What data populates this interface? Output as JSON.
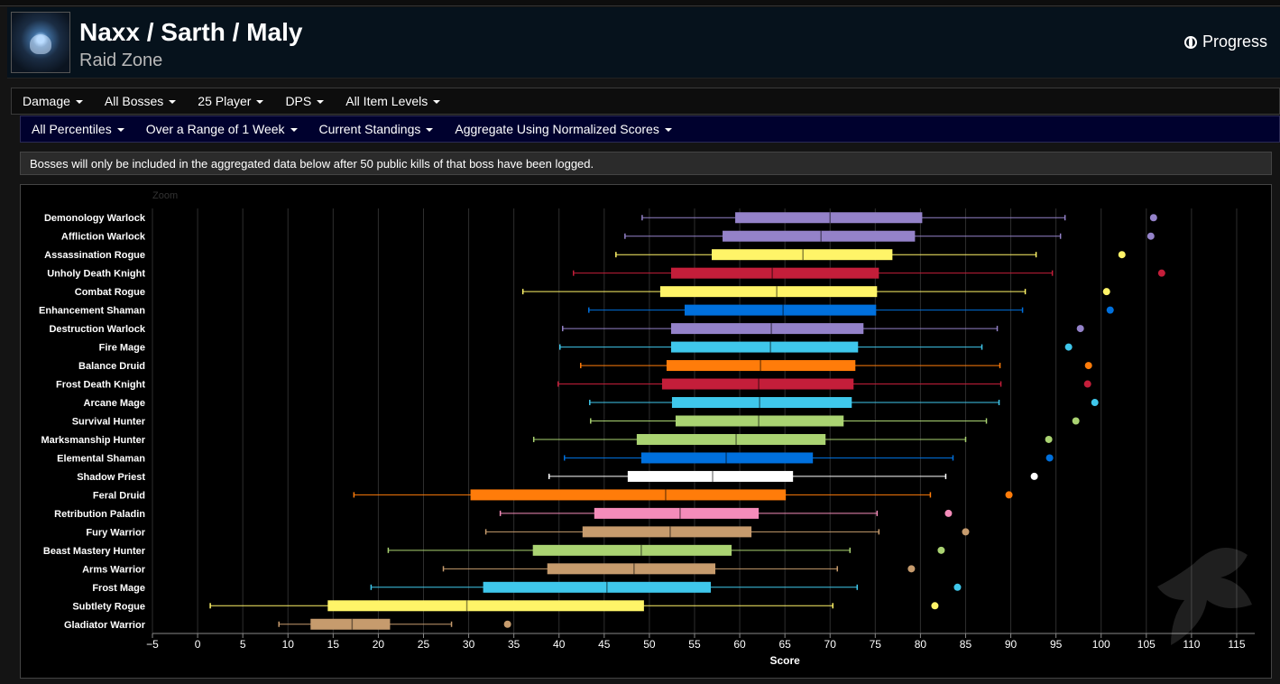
{
  "header": {
    "title": "Naxx / Sarth / Maly",
    "subtitle": "Raid Zone",
    "progress_label": "Progress",
    "icon": "raid-zone-icon"
  },
  "filters_row1": [
    "Damage",
    "All Bosses",
    "25 Player",
    "DPS",
    "All Item Levels"
  ],
  "filters_row2": [
    "All Percentiles",
    "Over a Range of 1 Week",
    "Current Standings",
    "Aggregate Using Normalized Scores"
  ],
  "notice": "Bosses will only be included in the aggregated data below after 50 public kills of that boss have been logged.",
  "chart_data": {
    "type": "boxplot",
    "orientation": "horizontal",
    "zoom_label": "Zoom",
    "xlabel": "Score",
    "xlim": [
      -5,
      117
    ],
    "xticks": [
      -5,
      0,
      5,
      10,
      15,
      20,
      25,
      30,
      35,
      40,
      45,
      50,
      55,
      60,
      65,
      70,
      75,
      80,
      85,
      90,
      95,
      100,
      105,
      110,
      115
    ],
    "grid": true,
    "series": [
      {
        "name": "Demonology Warlock",
        "color": "#9482C9",
        "min": 49.2,
        "q1": 59.5,
        "median": 70,
        "q3": 80.2,
        "max": 96,
        "outlier": 105.8
      },
      {
        "name": "Affliction Warlock",
        "color": "#9482C9",
        "min": 47.3,
        "q1": 58.1,
        "median": 69,
        "q3": 79.4,
        "max": 95.5,
        "outlier": 105.5
      },
      {
        "name": "Assassination Rogue",
        "color": "#FFF468",
        "min": 46.3,
        "q1": 56.9,
        "median": 67,
        "q3": 76.9,
        "max": 92.8,
        "outlier": 102.3
      },
      {
        "name": "Unholy Death Knight",
        "color": "#C41E3A",
        "min": 41.6,
        "q1": 52.4,
        "median": 63.6,
        "q3": 75.4,
        "max": 94.6,
        "outlier": 106.7
      },
      {
        "name": "Combat Rogue",
        "color": "#FFF468",
        "min": 36,
        "q1": 51.2,
        "median": 64.1,
        "q3": 75.2,
        "max": 91.6,
        "outlier": 100.6
      },
      {
        "name": "Enhancement Shaman",
        "color": "#0070DD",
        "min": 43.3,
        "q1": 53.9,
        "median": 64.8,
        "q3": 75.1,
        "max": 91.3,
        "outlier": 101
      },
      {
        "name": "Destruction Warlock",
        "color": "#9482C9",
        "min": 40.4,
        "q1": 52.4,
        "median": 63.5,
        "q3": 73.7,
        "max": 88.5,
        "outlier": 97.7
      },
      {
        "name": "Fire Mage",
        "color": "#3FC7EB",
        "min": 40.1,
        "q1": 52.4,
        "median": 63.4,
        "q3": 73.1,
        "max": 86.8,
        "outlier": 96.4
      },
      {
        "name": "Balance Druid",
        "color": "#FF7C0A",
        "min": 42.4,
        "q1": 51.9,
        "median": 62.3,
        "q3": 72.8,
        "max": 88.8,
        "outlier": 98.6
      },
      {
        "name": "Frost Death Knight",
        "color": "#C41E3A",
        "min": 39.9,
        "q1": 51.4,
        "median": 62.1,
        "q3": 72.6,
        "max": 88.9,
        "outlier": 98.5
      },
      {
        "name": "Arcane Mage",
        "color": "#3FC7EB",
        "min": 43.4,
        "q1": 52.5,
        "median": 62.2,
        "q3": 72.4,
        "max": 88.7,
        "outlier": 99.3
      },
      {
        "name": "Survival Hunter",
        "color": "#AAD372",
        "min": 43.5,
        "q1": 52.9,
        "median": 62.1,
        "q3": 71.5,
        "max": 87.3,
        "outlier": 97.2
      },
      {
        "name": "Marksmanship Hunter",
        "color": "#AAD372",
        "min": 37.2,
        "q1": 48.6,
        "median": 59.6,
        "q3": 69.5,
        "max": 85,
        "outlier": 94.2
      },
      {
        "name": "Elemental Shaman",
        "color": "#0070DD",
        "min": 40.6,
        "q1": 49.1,
        "median": 58.5,
        "q3": 68.1,
        "max": 83.6,
        "outlier": 94.3
      },
      {
        "name": "Shadow Priest",
        "color": "#FFFFFF",
        "min": 38.9,
        "q1": 47.6,
        "median": 57,
        "q3": 65.9,
        "max": 82.8,
        "outlier": 92.6
      },
      {
        "name": "Feral Druid",
        "color": "#FF7C0A",
        "min": 17.3,
        "q1": 30.2,
        "median": 51.8,
        "q3": 65.1,
        "max": 81.1,
        "outlier": 89.8
      },
      {
        "name": "Retribution Paladin",
        "color": "#F48CBA",
        "min": 33.5,
        "q1": 43.9,
        "median": 53.4,
        "q3": 62.1,
        "max": 75.2,
        "outlier": 83.1
      },
      {
        "name": "Fury Warrior",
        "color": "#C69B6D",
        "min": 31.9,
        "q1": 42.6,
        "median": 52.3,
        "q3": 61.3,
        "max": 75.4,
        "outlier": 85
      },
      {
        "name": "Beast Mastery Hunter",
        "color": "#AAD372",
        "min": 21.1,
        "q1": 37.1,
        "median": 49.1,
        "q3": 59.1,
        "max": 72.2,
        "outlier": 82.3
      },
      {
        "name": "Arms Warrior",
        "color": "#C69B6D",
        "min": 27.2,
        "q1": 38.7,
        "median": 48.3,
        "q3": 57.3,
        "max": 70.8,
        "outlier": 79
      },
      {
        "name": "Frost Mage",
        "color": "#3FC7EB",
        "min": 19.2,
        "q1": 31.6,
        "median": 45.3,
        "q3": 56.8,
        "max": 73,
        "outlier": 84.1
      },
      {
        "name": "Subtlety Rogue",
        "color": "#FFF468",
        "min": 1.4,
        "q1": 14.4,
        "median": 29.8,
        "q3": 49.4,
        "max": 70.3,
        "outlier": 81.6
      },
      {
        "name": "Gladiator Warrior",
        "color": "#C69B6D",
        "min": 9,
        "q1": 12.5,
        "median": 17.1,
        "q3": 21.3,
        "max": 28.1,
        "outlier": 34.3
      }
    ]
  }
}
